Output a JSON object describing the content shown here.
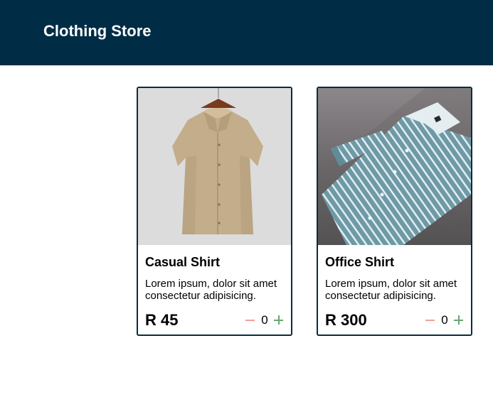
{
  "header": {
    "title": "Clothing Store",
    "background": "#002d45"
  },
  "products": [
    {
      "name": "Casual Shirt",
      "description": "Lorem ipsum, dolor sit amet consectetur adipisicing.",
      "price": "R 45",
      "quantity": "0",
      "image_icon": "khaki-short-sleeve-shirt-on-hanger"
    },
    {
      "name": "Office Shirt",
      "description": "Lorem ipsum, dolor sit amet consectetur adipisicing.",
      "price": "R 300",
      "quantity": "0",
      "image_icon": "folded-blue-striped-long-sleeve-shirt"
    }
  ],
  "colors": {
    "card_border": "#0a2c3d",
    "minus": "#f2a09a",
    "plus": "#6aa56f"
  }
}
